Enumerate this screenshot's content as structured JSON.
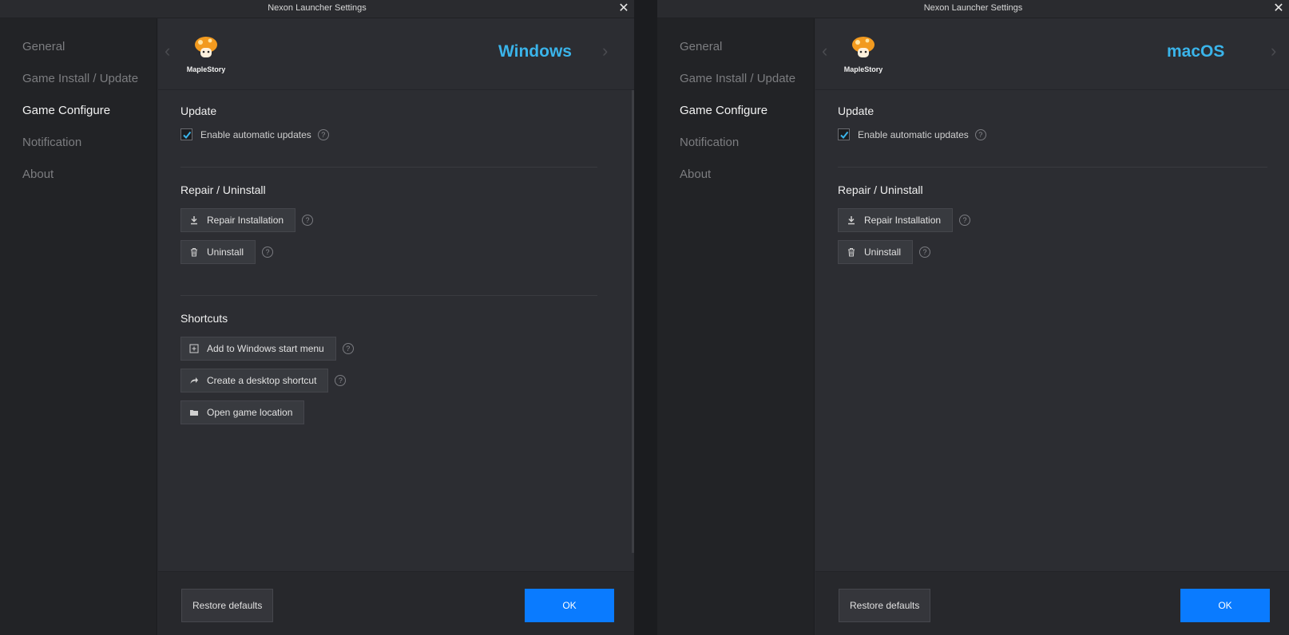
{
  "colors": {
    "accent": "#3ab4ea",
    "ok_button": "#0a7bff",
    "background": "#2c2d32",
    "sidebar": "#222326"
  },
  "windows": [
    {
      "title": "Nexon Launcher Settings",
      "close_glyph": "✕",
      "nav": [
        "General",
        "Game Install / Update",
        "Game Configure",
        "Notification",
        "About"
      ],
      "active_nav": "Game Configure",
      "game": {
        "name": "MapleStory",
        "logo_icon": "mushroom-icon"
      },
      "platform": "Windows",
      "update": {
        "title": "Update",
        "auto_update_label": "Enable automatic updates",
        "auto_update_checked": true
      },
      "repair": {
        "title": "Repair / Uninstall",
        "repair_label": "Repair Installation",
        "uninstall_label": "Uninstall"
      },
      "shortcuts": {
        "title": "Shortcuts",
        "start_menu_label": "Add to Windows start menu",
        "desktop_label": "Create a desktop shortcut",
        "open_location_label": "Open game location"
      },
      "footer": {
        "restore_label": "Restore defaults",
        "ok_label": "OK"
      }
    },
    {
      "title": "Nexon Launcher Settings",
      "close_glyph": "✕",
      "nav": [
        "General",
        "Game Install / Update",
        "Game Configure",
        "Notification",
        "About"
      ],
      "active_nav": "Game Configure",
      "game": {
        "name": "MapleStory",
        "logo_icon": "mushroom-icon"
      },
      "platform": "macOS",
      "update": {
        "title": "Update",
        "auto_update_label": "Enable automatic updates",
        "auto_update_checked": true
      },
      "repair": {
        "title": "Repair / Uninstall",
        "repair_label": "Repair Installation",
        "uninstall_label": "Uninstall"
      },
      "footer": {
        "restore_label": "Restore defaults",
        "ok_label": "OK"
      }
    }
  ]
}
